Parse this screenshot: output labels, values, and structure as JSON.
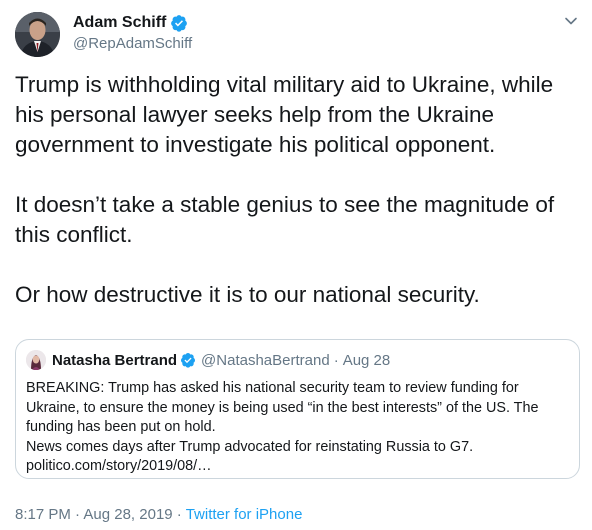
{
  "author": {
    "display_name": "Adam Schiff",
    "handle": "@RepAdamSchiff",
    "verified": true,
    "avatar": "avatar-photo"
  },
  "tweet": {
    "paragraphs": [
      "Trump is withholding vital military aid to Ukraine, while his personal lawyer seeks help from the Ukraine government to investigate his political opponent.",
      "It doesn’t take a stable genius to see the magnitude of this conflict.",
      "Or how destructive it is to our national security."
    ]
  },
  "quoted": {
    "display_name": "Natasha Bertrand",
    "handle": "@NatashaBertrand",
    "separator": "·",
    "date": "Aug 28",
    "verified": true,
    "lines": [
      "BREAKING: Trump has asked his national security team to review funding for",
      "Ukraine, to ensure the money is being used “in the best interests” of the US. The",
      "funding has been put on hold.",
      "News comes days after Trump advocated for reinstating Russia to G7.",
      "politico.com/story/2019/08/…"
    ]
  },
  "meta": {
    "time": "8:17 PM",
    "sep1": " · ",
    "date": "Aug 28, 2019",
    "sep2": " · ",
    "source": "Twitter for iPhone"
  },
  "colors": {
    "verified": "#1da1f2",
    "link": "#1da1f2",
    "secondary_text": "#657786",
    "border": "#ccd6dd"
  },
  "icons": {
    "verified": "verified-badge-icon",
    "caret": "chevron-down-icon"
  }
}
